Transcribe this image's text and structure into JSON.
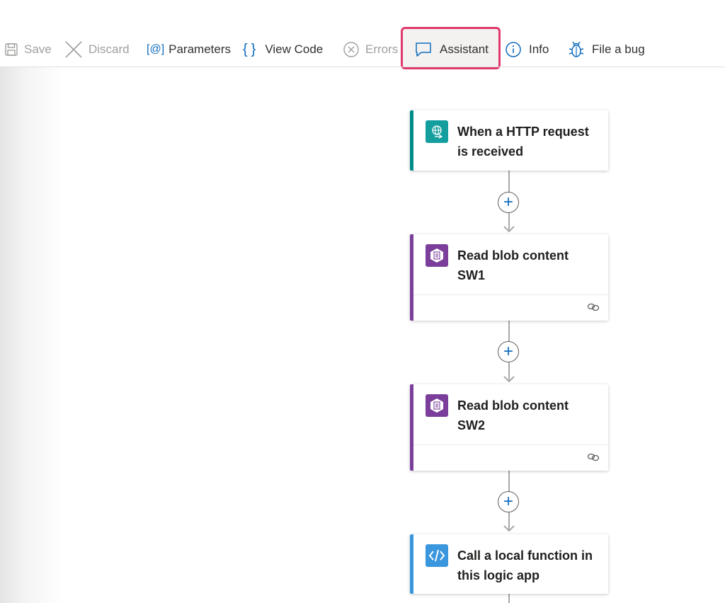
{
  "toolbar": {
    "save": "Save",
    "discard": "Discard",
    "parameters": "Parameters",
    "parameters_glyph": "[@]",
    "view_code": "View Code",
    "view_code_glyph": "{}",
    "errors": "Errors",
    "assistant": "Assistant",
    "info": "Info",
    "file_bug": "File a bug"
  },
  "workflow": {
    "steps": [
      {
        "title_line1": "When a HTTP request",
        "title_line2": "is received",
        "accent": "#008b8b",
        "badge_color": "#149e9e",
        "icon": "http-request-icon"
      },
      {
        "title_line1": "Read blob content",
        "title_line2": "SW1",
        "accent": "#7b3f9b",
        "badge_color": "#7b3f9b",
        "icon": "blob-storage-icon"
      },
      {
        "title_line1": "Read blob content",
        "title_line2": "SW2",
        "accent": "#7b3f9b",
        "badge_color": "#7b3f9b",
        "icon": "blob-storage-icon"
      },
      {
        "title_line1": "Call a local function in",
        "title_line2": "this logic app",
        "accent": "#3a96dd",
        "badge_color": "#3a96dd",
        "icon": "code-icon"
      }
    ],
    "add_step_symbol": "+"
  },
  "colors": {
    "highlight_border": "#e0386b",
    "accent_blue": "#0f6cbd",
    "disabled_text": "#a19f9d"
  }
}
